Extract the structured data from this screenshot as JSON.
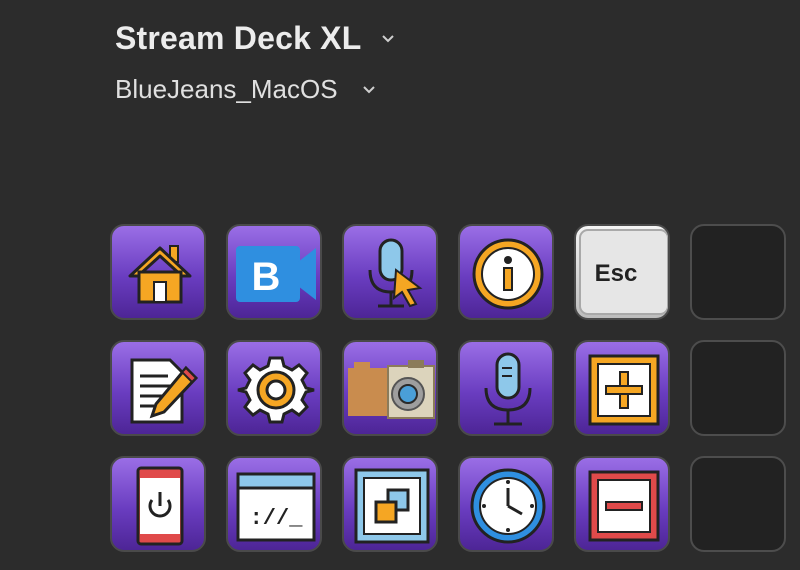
{
  "header": {
    "device_name": "Stream Deck XL",
    "profile_name": "BlueJeans_MacOS"
  },
  "keys": [
    {
      "row": 1,
      "col": 1,
      "icon": "home-icon"
    },
    {
      "row": 1,
      "col": 2,
      "icon": "bluejeans-logo-icon"
    },
    {
      "row": 1,
      "col": 3,
      "icon": "microphone-cursor-icon"
    },
    {
      "row": 1,
      "col": 4,
      "icon": "info-icon"
    },
    {
      "row": 1,
      "col": 5,
      "icon": "esc-key-icon",
      "label": "Esc"
    },
    {
      "row": 1,
      "col": 6,
      "icon": "empty"
    },
    {
      "row": 2,
      "col": 1,
      "icon": "document-pencil-icon"
    },
    {
      "row": 2,
      "col": 2,
      "icon": "gear-icon"
    },
    {
      "row": 2,
      "col": 3,
      "icon": "camera-icon"
    },
    {
      "row": 2,
      "col": 4,
      "icon": "microphone-icon"
    },
    {
      "row": 2,
      "col": 5,
      "icon": "plus-box-icon"
    },
    {
      "row": 2,
      "col": 6,
      "icon": "empty"
    },
    {
      "row": 3,
      "col": 1,
      "icon": "phone-power-icon"
    },
    {
      "row": 3,
      "col": 2,
      "icon": "terminal-window-icon",
      "label": "://_"
    },
    {
      "row": 3,
      "col": 3,
      "icon": "layers-square-icon"
    },
    {
      "row": 3,
      "col": 4,
      "icon": "clock-icon"
    },
    {
      "row": 3,
      "col": 5,
      "icon": "minus-box-icon"
    },
    {
      "row": 3,
      "col": 6,
      "icon": "empty"
    }
  ],
  "colors": {
    "background": "#2c2c2c",
    "key_purple_top": "#9a6ee6",
    "key_purple_bottom": "#4d2596",
    "icon_orange": "#f5a623",
    "icon_blue": "#2f8fe0"
  }
}
